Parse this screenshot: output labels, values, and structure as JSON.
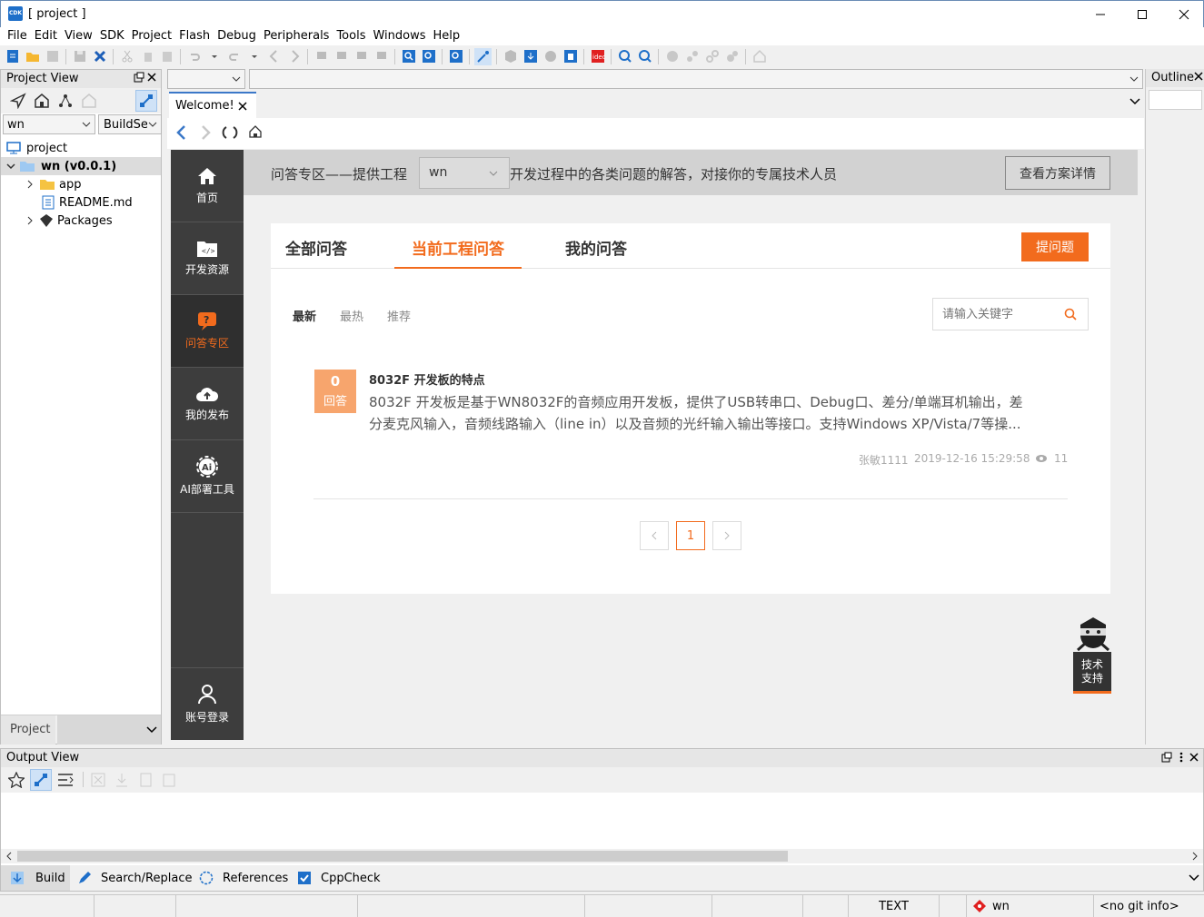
{
  "window": {
    "title": "[ project ]",
    "logo_text": "CDK"
  },
  "menu": [
    "File",
    "Edit",
    "View",
    "SDK",
    "Project",
    "Flash",
    "Debug",
    "Peripherals",
    "Tools",
    "Windows",
    "Help"
  ],
  "project_pane": {
    "title": "Project View",
    "project_select": "wn",
    "build_select": "BuildSet",
    "tree": {
      "root": "project",
      "node": "wn (v0.0.1)",
      "children": [
        "app",
        "README.md",
        "Packages"
      ]
    },
    "bottom_label": "Project"
  },
  "outline": {
    "title": "Outline"
  },
  "tabs": {
    "welcome": "Welcome!"
  },
  "web": {
    "nav": [
      {
        "label": "首页",
        "icon": "home-icon"
      },
      {
        "label": "开发资源",
        "icon": "code-folder-icon"
      },
      {
        "label": "问答专区",
        "icon": "qa-bubble-icon"
      },
      {
        "label": "我的发布",
        "icon": "cloud-upload-icon"
      },
      {
        "label": "AI部署工具",
        "icon": "ai-gear-icon"
      }
    ],
    "login_label": "账号登录",
    "header": {
      "prefix": "问答专区——提供工程",
      "select_value": "wn",
      "suffix": "开发过程中的各类问题的解答，对接你的专属技术人员",
      "detail_button": "查看方案详情"
    },
    "tabs": [
      "全部问答",
      "当前工程问答",
      "我的问答"
    ],
    "ask_button": "提问题",
    "filters": [
      "最新",
      "最热",
      "推荐"
    ],
    "search_placeholder": "请输入关键字",
    "question": {
      "answers_count": "0",
      "answers_label": "回答",
      "title": "8032F 开发板的特点",
      "line1": "8032F 开发板是基于WN8032F的音频应用开发板，提供了USB转串口、Debug口、差分/单端耳机输出，差",
      "line2": "分麦克风输入，音频线路输入（line in）以及音频的光纤输入输出等接口。支持Windows XP/Vista/7等操...",
      "author": "张敏1111",
      "date": "2019-12-16 15:29:58",
      "views": "11"
    },
    "pagination": {
      "current": "1"
    },
    "support": {
      "line1": "技术",
      "line2": "支持"
    }
  },
  "output": {
    "title": "Output View",
    "tabs": [
      "Build",
      "Search/Replace",
      "References",
      "CppCheck"
    ]
  },
  "status": {
    "mode": "TEXT",
    "project": "wn",
    "git": "<no git info>"
  },
  "colors": {
    "accent": "#f26b1d",
    "nav_bg": "#3d3d3d",
    "link_blue": "#3b78c8"
  }
}
